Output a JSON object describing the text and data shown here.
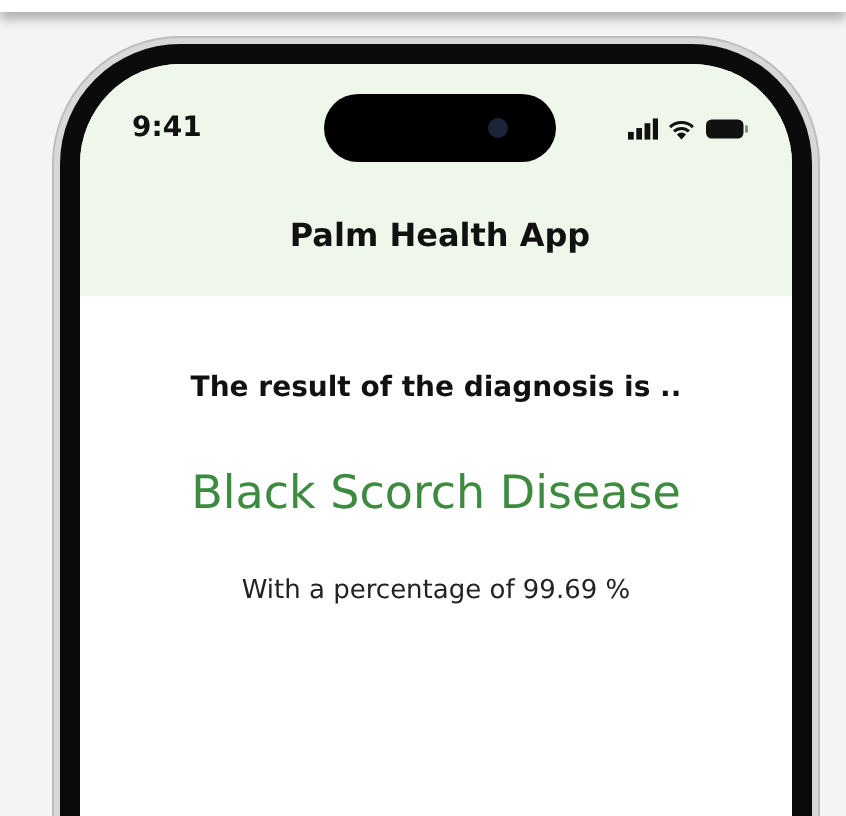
{
  "status_bar": {
    "time": "9:41"
  },
  "header": {
    "title": "Palm Health App"
  },
  "result": {
    "intro": "The result of the diagnosis is ..",
    "disease": "Black Scorch Disease",
    "confidence": "With a percentage of 99.69 %"
  }
}
